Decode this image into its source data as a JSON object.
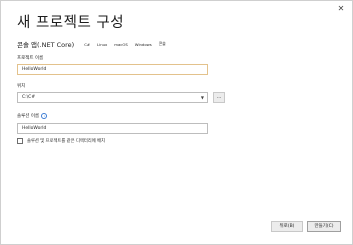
{
  "window": {
    "close_glyph": "✕",
    "title": "새 프로젝트 구성"
  },
  "template": {
    "name": "콘솔 앱(.NET Core)",
    "tags": [
      "C#",
      "Linux",
      "macOS",
      "Windows",
      "콘솔"
    ]
  },
  "project_name": {
    "label": "프로젝트 이름",
    "value": "HelloWorld"
  },
  "location": {
    "label": "위치",
    "value": "C:\\C#",
    "browse_label": "..."
  },
  "solution_name": {
    "label": "솔루션 이름",
    "info_glyph": "i",
    "value": "HelloWorld"
  },
  "same_directory": {
    "label": "솔루션 및 프로젝트를 같은 디렉터리에 배치",
    "checked": false
  },
  "footer": {
    "back_label": "뒤로(B)",
    "create_label": "만들기(C)"
  }
}
